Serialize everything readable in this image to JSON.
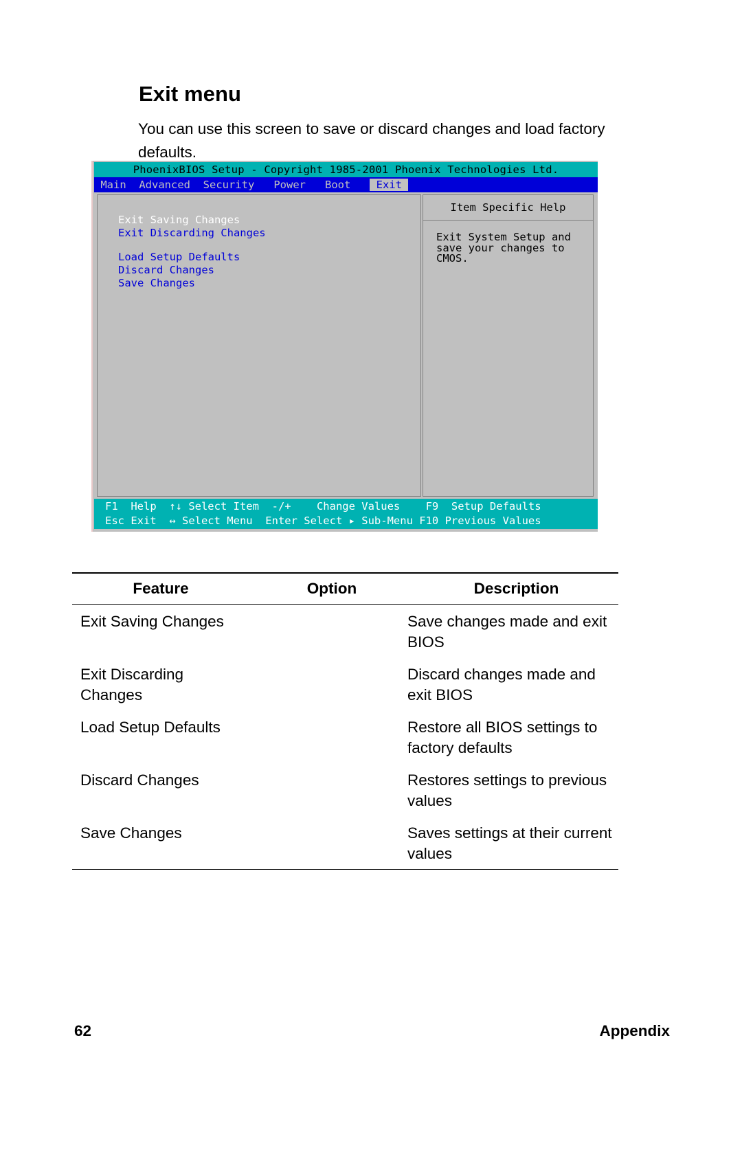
{
  "section": {
    "heading": "Exit menu",
    "intro": "You can use this screen to save or discard changes and load factory defaults."
  },
  "bios": {
    "title": "PhoenixBIOS Setup - Copyright 1985-2001 Phoenix Technologies Ltd.",
    "tabs": [
      {
        "label": "Main",
        "active": false
      },
      {
        "label": "Advanced",
        "active": false
      },
      {
        "label": "Security",
        "active": false
      },
      {
        "label": "Power",
        "active": false
      },
      {
        "label": "Boot",
        "active": false
      },
      {
        "label": "Exit",
        "active": true
      }
    ],
    "menu_items": [
      {
        "label": "Exit Saving Changes",
        "selected": true
      },
      {
        "label": "Exit Discarding Changes",
        "selected": false
      },
      {
        "label": "Load Setup Defaults",
        "selected": false
      },
      {
        "label": "Discard Changes",
        "selected": false
      },
      {
        "label": "Save Changes",
        "selected": false
      }
    ],
    "help": {
      "title": "Item Specific Help",
      "text": "Exit System Setup and\nsave your changes to\nCMOS."
    },
    "footer": {
      "row1": "F1  Help  ↑↓ Select Item  -/+    Change Values    F9  Setup Defaults",
      "row2": "Esc Exit  ↔ Select Menu  Enter Select ▸ Sub-Menu F10 Previous Values"
    },
    "colors": {
      "title_bar": "#00b2b2",
      "menu_bar": "#0000d8",
      "panel": "#c0c0c0",
      "menu_text": "#0000d8",
      "selected_text": "#ffffff",
      "footer_bar": "#00b2b2"
    }
  },
  "table": {
    "headers": {
      "feature": "Feature",
      "option": "Option",
      "description": "Description"
    },
    "rows": [
      {
        "feature": "Exit Saving Changes",
        "option": "",
        "description": "Save changes made and exit BIOS"
      },
      {
        "feature": "Exit Discarding Changes",
        "option": "",
        "description": "Discard changes made and exit BIOS"
      },
      {
        "feature": "Load Setup Defaults",
        "option": "",
        "description": "Restore all BIOS settings to factory defaults"
      },
      {
        "feature": "Discard Changes",
        "option": "",
        "description": "Restores settings to previous values"
      },
      {
        "feature": "Save Changes",
        "option": "",
        "description": "Saves settings at their current values"
      }
    ]
  },
  "page_footer": {
    "number": "62",
    "label": "Appendix"
  }
}
